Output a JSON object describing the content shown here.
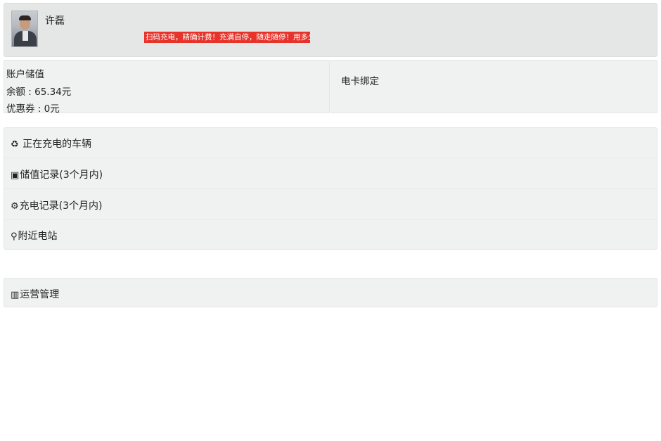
{
  "header": {
    "username": "许磊",
    "marquee_text": "扫码充电，精确计费！充满自停，随走随停！用多少扣多少，不"
  },
  "account": {
    "title": "账户储值",
    "balance_label": "余额 : 65.34元",
    "coupon_label": "优惠券 : 0元",
    "card_bind_label": "电卡绑定"
  },
  "menu": {
    "items": [
      {
        "icon": "♻",
        "label": "正在充电的车辆",
        "icon_name": "recycle-icon"
      },
      {
        "icon": "▣",
        "label": "储值记录(3个月内)",
        "icon_name": "money-icon"
      },
      {
        "icon": "⚙",
        "label": "充电记录(3个月内)",
        "icon_name": "charge-icon"
      },
      {
        "icon": "⚲",
        "label": "附近电站",
        "icon_name": "pin-icon"
      }
    ]
  },
  "ops": {
    "icon": "▥",
    "label": "运营管理",
    "icon_name": "building-icon"
  },
  "colors": {
    "header_bg": "#e5e7e6",
    "panel_bg": "#eff2f1",
    "marquee_bg": "#e8332a"
  }
}
